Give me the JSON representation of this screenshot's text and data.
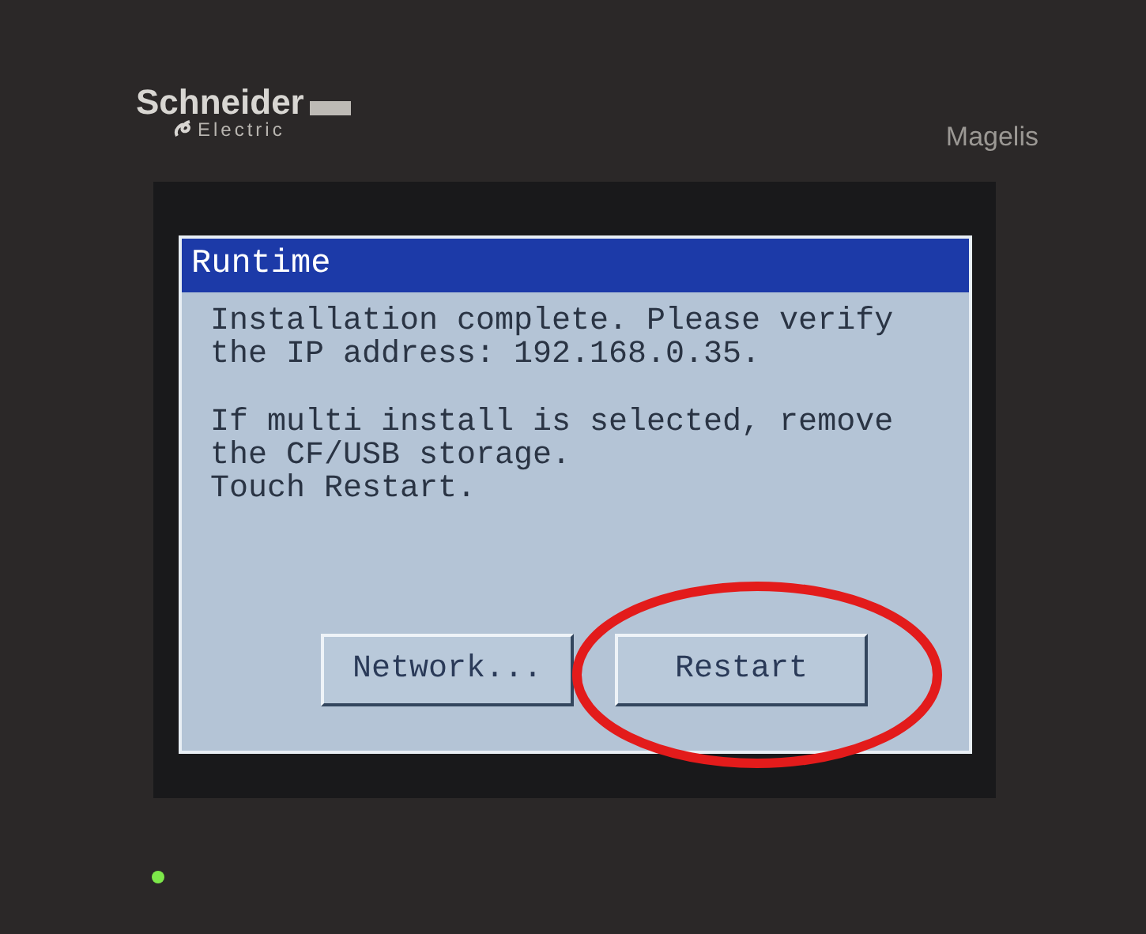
{
  "device": {
    "brand": "Schneider",
    "brand_sub": "Electric",
    "model": "Magelis",
    "power_led": {
      "on": true
    }
  },
  "dialog": {
    "title": "Runtime",
    "blocks": [
      [
        "Installation complete. Please verify the IP address: 192.168.0.35."
      ],
      [
        "If multi install is selected, remove the CF/USB storage.",
        "Touch Restart."
      ]
    ],
    "buttons": [
      {
        "label": "Network...",
        "highlighted": false
      },
      {
        "label": "Restart",
        "highlighted": true
      }
    ]
  }
}
